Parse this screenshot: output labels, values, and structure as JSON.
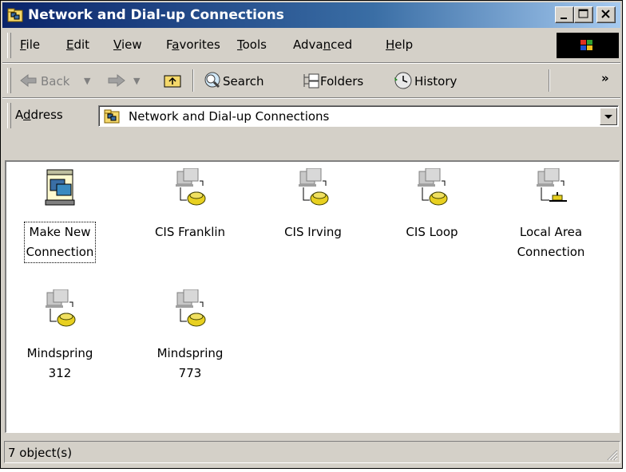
{
  "window": {
    "title": "Network and Dial-up Connections"
  },
  "menu": [
    {
      "label": "File",
      "key": "F",
      "rest": "ile"
    },
    {
      "label": "Edit",
      "key": "E",
      "rest": "dit"
    },
    {
      "label": "View",
      "key": "V",
      "rest": "iew"
    },
    {
      "label": "Favorites",
      "pre": "F",
      "key": "a",
      "rest": "vorites"
    },
    {
      "label": "Tools",
      "key": "T",
      "rest": "ools"
    },
    {
      "label": "Advanced",
      "pre": "Adva",
      "key": "n",
      "rest": "ced"
    },
    {
      "label": "Help",
      "key": "H",
      "rest": "elp"
    }
  ],
  "toolbar": {
    "back_label": "Back",
    "search_label": "Search",
    "folders_label": "Folders",
    "history_label": "History",
    "more_glyph": "»"
  },
  "address": {
    "label_pre": "A",
    "label_key": "d",
    "label_rest": "dress",
    "value": "Network and Dial-up Connections"
  },
  "items": [
    {
      "line1": "Make New",
      "line2": "Connection",
      "icon": "make-new-connection-icon"
    },
    {
      "line1": "CIS Franklin",
      "line2": "",
      "icon": "dialup-connection-icon"
    },
    {
      "line1": "CIS Irving",
      "line2": "",
      "icon": "dialup-connection-icon"
    },
    {
      "line1": "CIS Loop",
      "line2": "",
      "icon": "dialup-connection-icon"
    },
    {
      "line1": "Local Area",
      "line2": "Connection",
      "icon": "lan-connection-icon"
    },
    {
      "line1": "Mindspring",
      "line2": "312",
      "icon": "dialup-connection-icon"
    },
    {
      "line1": "Mindspring",
      "line2": "773",
      "icon": "dialup-connection-icon"
    }
  ],
  "status": {
    "text": "7 object(s)"
  }
}
